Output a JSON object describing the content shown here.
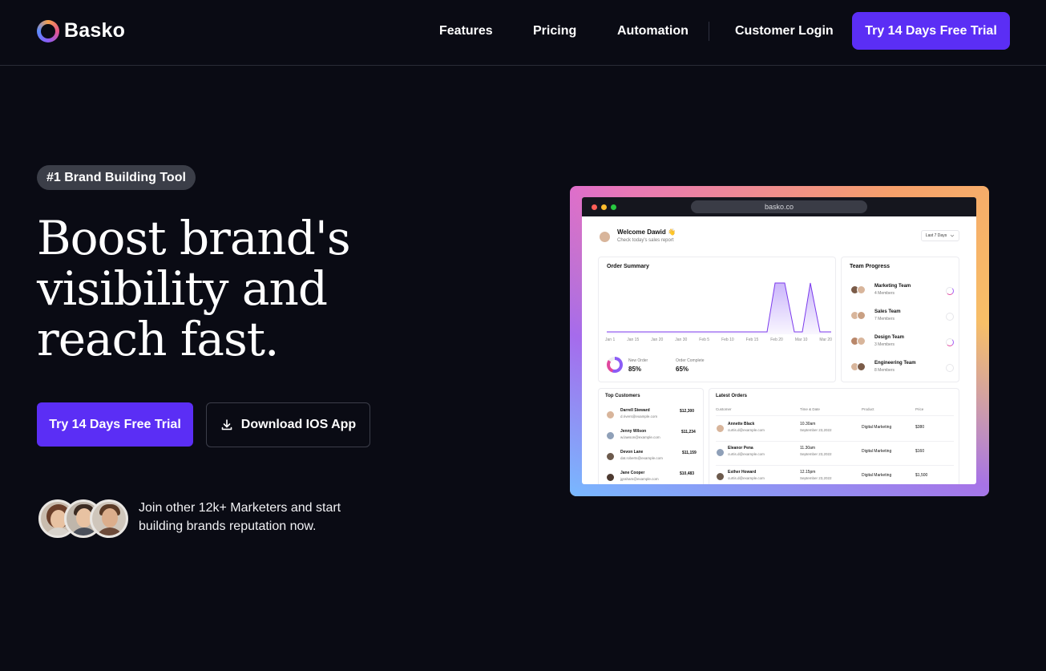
{
  "nav": {
    "logo": "Basko",
    "links": [
      "Features",
      "Pricing",
      "Automation",
      "Customer Login"
    ],
    "cta": "Try 14 Days Free Trial"
  },
  "hero": {
    "badge": "#1 Brand Building Tool",
    "headline_lines": [
      "Boost brand's",
      "visibility and",
      "reach fast."
    ],
    "primary_button": "Try 14 Days Free Trial",
    "secondary_button": "Download IOS App",
    "social_proof_lines": [
      "Join other 12k+ Marketers and start",
      "building brands reputation now."
    ]
  },
  "dashboard": {
    "url": "basko.co",
    "welcome": "Welcome Dawid 👋",
    "subtitle": "Check today's sales report",
    "range_select": "Last 7 Days",
    "order_summary": {
      "title": "Order Summary",
      "x_labels": [
        "Jan 1",
        "Jan 15",
        "Jan 20",
        "Jan 30",
        "Feb 5",
        "Feb 10",
        "Feb 15",
        "Feb 20",
        "Mar 10",
        "Mar 20"
      ],
      "stats": [
        {
          "label": "New Order",
          "value": "85%"
        },
        {
          "label": "Order Complete",
          "value": "65%"
        }
      ]
    },
    "team_progress": {
      "title": "Team Progress",
      "teams": [
        {
          "name": "Marketing Team",
          "members": "4 Members",
          "active": true
        },
        {
          "name": "Sales Team",
          "members": "7 Members",
          "active": false
        },
        {
          "name": "Design Team",
          "members": "3 Members",
          "active": true
        },
        {
          "name": "Engineering Team",
          "members": "8 Members",
          "active": false
        }
      ]
    },
    "top_customers": {
      "title": "Top Customers",
      "rows": [
        {
          "name": "Darrell Steward",
          "email": "d.rivers@example.com",
          "amount": "$12,300"
        },
        {
          "name": "Jenny Wilson",
          "email": "w.lawson@example.com",
          "amount": "$11,234"
        },
        {
          "name": "Devon Lane",
          "email": "dat.roberts@example.com",
          "amount": "$11,159"
        },
        {
          "name": "Jane Cooper",
          "email": "jgraham@example.com",
          "amount": "$10,483"
        }
      ]
    },
    "latest_orders": {
      "title": "Latest Orders",
      "headers": [
        "Customer",
        "Time & Date",
        "Product",
        "Price"
      ],
      "rows": [
        {
          "name": "Annette Black",
          "email": "curtis.d@example.com",
          "time": "10.30am",
          "date": "September 23,2022",
          "product": "Digital Marketing",
          "price": "$380"
        },
        {
          "name": "Eleanor Pena",
          "email": "curtis.d@example.com",
          "time": "11.30am",
          "date": "September 23,2022",
          "product": "Digital Marketing",
          "price": "$160"
        },
        {
          "name": "Esther Howard",
          "email": "curtis.d@example.com",
          "time": "12.15pm",
          "date": "September 23,2022",
          "product": "Digital Marketing",
          "price": "$1,500"
        }
      ]
    }
  },
  "colors": {
    "background": "#0a0b14",
    "accent": "#5b2ef5",
    "badge": "#3b3e48"
  },
  "icons": {
    "logo": "ring-logo-icon",
    "download": "download-icon",
    "dropdown": "chevron-down-icon"
  }
}
